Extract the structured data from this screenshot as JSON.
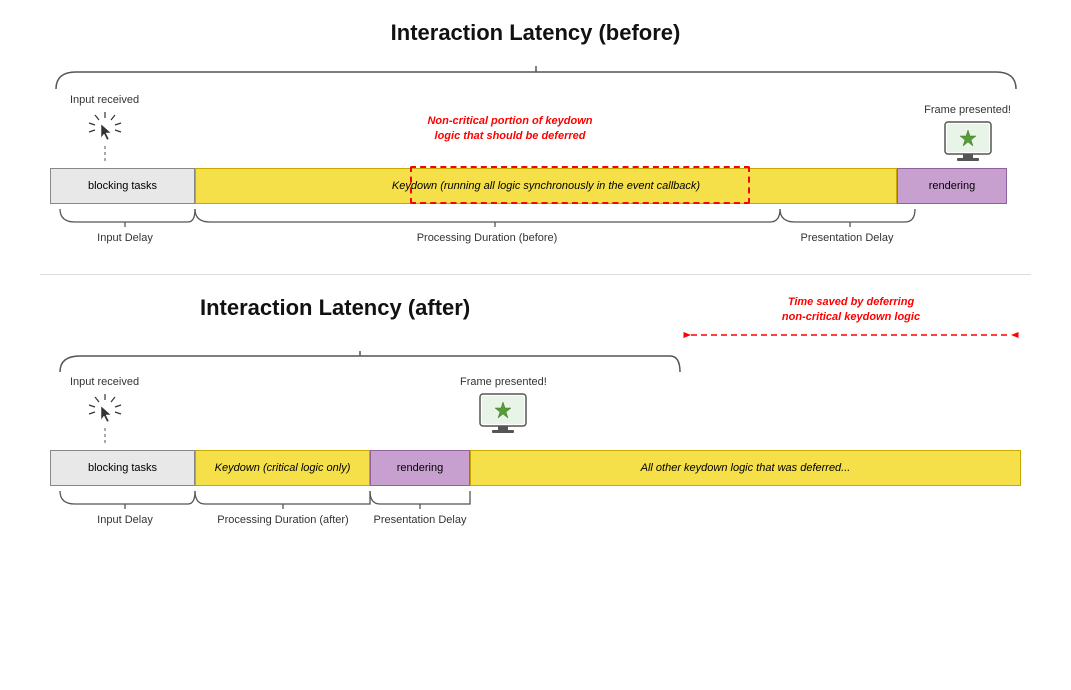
{
  "diagram": {
    "section1": {
      "title": "Interaction Latency (before)",
      "input_received": "Input received",
      "frame_presented": "Frame presented!",
      "bar_blocking": "blocking tasks",
      "bar_keydown": "Keydown (running all logic synchronously in the event callback)",
      "bar_rendering": "rendering",
      "label_input_delay": "Input Delay",
      "label_processing": "Processing Duration (before)",
      "label_presentation": "Presentation Delay",
      "annotation_text": "Non-critical portion of keydown\nlogic that should be deferred"
    },
    "section2": {
      "title": "Interaction Latency (after)",
      "input_received": "Input received",
      "frame_presented": "Frame presented!",
      "bar_blocking": "blocking tasks",
      "bar_keydown": "Keydown (critical logic only)",
      "bar_rendering": "rendering",
      "bar_deferred": "All other keydown logic that was deferred...",
      "label_input_delay": "Input Delay",
      "label_processing": "Processing Duration (after)",
      "label_presentation": "Presentation Delay",
      "time_saved_text": "Time saved by deferring\nnon-critical keydown logic"
    }
  }
}
